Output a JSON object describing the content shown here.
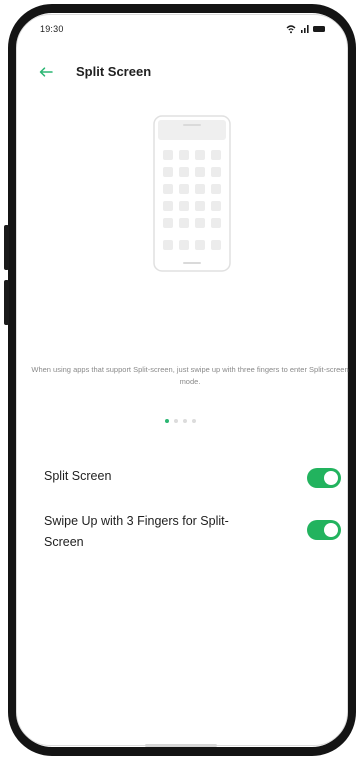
{
  "status_bar": {
    "time": "19:30"
  },
  "header": {
    "title": "Split Screen",
    "back_icon": "arrow-left-icon"
  },
  "description": "When using apps that support Split-screen, just swipe up with three fingers to enter Split-screen mode.",
  "pager": {
    "total": 4,
    "active_index": 0
  },
  "settings": [
    {
      "label": "Split Screen",
      "enabled": true
    },
    {
      "label": "Swipe Up with 3 Fingers for Split-Screen",
      "enabled": true
    }
  ],
  "colors": {
    "accent": "#22b35e",
    "back_arrow": "#2bb673"
  }
}
